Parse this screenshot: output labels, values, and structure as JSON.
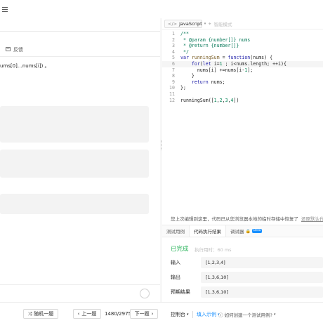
{
  "left": {
    "feedback_label": "反馈",
    "description_line": "ums[0]…nums[i]) 。",
    "gray_blocks": 3
  },
  "editor": {
    "language": "JavaScript",
    "smart_mode": "智能模式",
    "code_lines": [
      {
        "n": "1",
        "active": false,
        "tokens": [
          {
            "t": "/**",
            "c": "c-comment"
          }
        ]
      },
      {
        "n": "2",
        "active": false,
        "tokens": [
          {
            "t": " * @param {number[]} nums",
            "c": "c-comment"
          }
        ]
      },
      {
        "n": "3",
        "active": false,
        "tokens": [
          {
            "t": " * @return {number[]}",
            "c": "c-comment"
          }
        ]
      },
      {
        "n": "4",
        "active": false,
        "tokens": [
          {
            "t": " */",
            "c": "c-comment"
          }
        ]
      },
      {
        "n": "5",
        "active": false,
        "tokens": [
          {
            "t": "var ",
            "c": "c-kw"
          },
          {
            "t": "runningSum",
            "c": "c-fn"
          },
          {
            "t": " = ",
            "c": "c-plain"
          },
          {
            "t": "function",
            "c": "c-kw"
          },
          {
            "t": "(nums) {",
            "c": "c-plain"
          }
        ]
      },
      {
        "n": "6",
        "active": true,
        "tokens": [
          {
            "t": "    ",
            "c": "c-plain"
          },
          {
            "t": "for",
            "c": "c-kw"
          },
          {
            "t": "(",
            "c": "c-plain"
          },
          {
            "t": "let",
            "c": "c-kw"
          },
          {
            "t": " i=",
            "c": "c-plain"
          },
          {
            "t": "1",
            "c": "c-num"
          },
          {
            "t": " ; i<nums.length; ++i){",
            "c": "c-plain"
          }
        ]
      },
      {
        "n": "7",
        "active": false,
        "tokens": [
          {
            "t": "      nums[i] +=nums[i-",
            "c": "c-plain"
          },
          {
            "t": "1",
            "c": "c-num"
          },
          {
            "t": "];",
            "c": "c-plain"
          }
        ]
      },
      {
        "n": "8",
        "active": false,
        "tokens": [
          {
            "t": "    }",
            "c": "c-plain"
          }
        ]
      },
      {
        "n": "9",
        "active": false,
        "tokens": [
          {
            "t": "    ",
            "c": "c-plain"
          },
          {
            "t": "return",
            "c": "c-kw"
          },
          {
            "t": " nums;",
            "c": "c-plain"
          }
        ]
      },
      {
        "n": "10",
        "active": false,
        "tokens": [
          {
            "t": "};",
            "c": "c-plain"
          }
        ]
      },
      {
        "n": "11",
        "active": false,
        "tokens": []
      },
      {
        "n": "12",
        "active": false,
        "tokens": [
          {
            "t": "runningSum([",
            "c": "c-plain"
          },
          {
            "t": "1",
            "c": "c-num"
          },
          {
            "t": ",",
            "c": "c-plain"
          },
          {
            "t": "2",
            "c": "c-num"
          },
          {
            "t": ",",
            "c": "c-plain"
          },
          {
            "t": "3",
            "c": "c-num"
          },
          {
            "t": ",",
            "c": "c-plain"
          },
          {
            "t": "4",
            "c": "c-num"
          },
          {
            "t": "])",
            "c": "c-plain"
          }
        ]
      }
    ]
  },
  "restore": {
    "message": "您上次编辑到这里，代码已从您浏览器本地的临时存储中恢复了",
    "link": "还原默认代码模板"
  },
  "tabs": {
    "test_case": "测试用例",
    "run_result": "代码执行结果",
    "debugger": "调试器",
    "beta": "Beta"
  },
  "result": {
    "status": "已完成",
    "exec_time": "执行用时：60 ms",
    "rows": [
      {
        "label": "输入",
        "value": "[1,2,3,4]"
      },
      {
        "label": "输出",
        "value": "[1,3,6,10]"
      },
      {
        "label": "预期结果",
        "value": "[1,3,6,10]"
      }
    ]
  },
  "bottom": {
    "random": "随机一题",
    "prev": "上一题",
    "page": "1480/2975",
    "next": "下一题",
    "console": "控制台",
    "fill_example": "填入示例",
    "help": "如何创建一个测试用例?"
  }
}
